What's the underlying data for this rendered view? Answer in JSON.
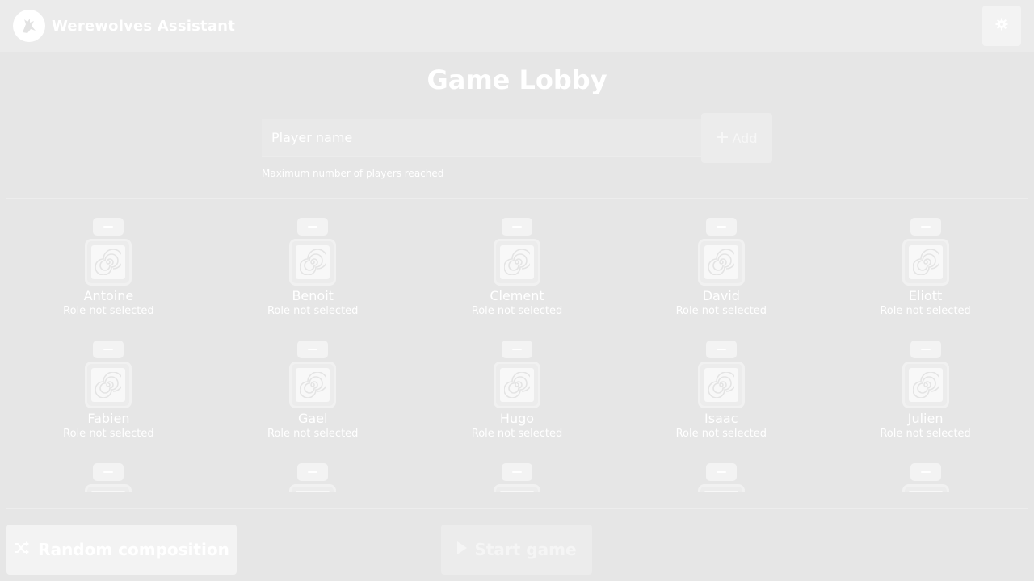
{
  "app": {
    "title": "Werewolves Assistant",
    "logo_icon": "werewolf-logo-icon",
    "settings_icon": "gear-icon"
  },
  "page": {
    "title": "Game Lobby"
  },
  "player_form": {
    "placeholder": "Player name",
    "value": "",
    "add_label": "Add",
    "add_icon": "plus-icon",
    "helper": "Maximum number of players reached"
  },
  "players": [
    {
      "name": "Antoine",
      "role": "Role not selected"
    },
    {
      "name": "Benoit",
      "role": "Role not selected"
    },
    {
      "name": "Clement",
      "role": "Role not selected"
    },
    {
      "name": "David",
      "role": "Role not selected"
    },
    {
      "name": "Eliott",
      "role": "Role not selected"
    },
    {
      "name": "Fabien",
      "role": "Role not selected"
    },
    {
      "name": "Gael",
      "role": "Role not selected"
    },
    {
      "name": "Hugo",
      "role": "Role not selected"
    },
    {
      "name": "Isaac",
      "role": "Role not selected"
    },
    {
      "name": "Julien",
      "role": "Role not selected"
    },
    {
      "name": "",
      "role": ""
    },
    {
      "name": "",
      "role": ""
    },
    {
      "name": "",
      "role": ""
    },
    {
      "name": "",
      "role": ""
    },
    {
      "name": "",
      "role": ""
    }
  ],
  "footer": {
    "random_label": "Random composition",
    "random_icon": "shuffle-icon",
    "start_label": "Start game",
    "start_icon": "play-icon"
  },
  "colors": {
    "background": "#e6e6e6",
    "navbar": "#ebebeb",
    "text": "#ffffff"
  }
}
